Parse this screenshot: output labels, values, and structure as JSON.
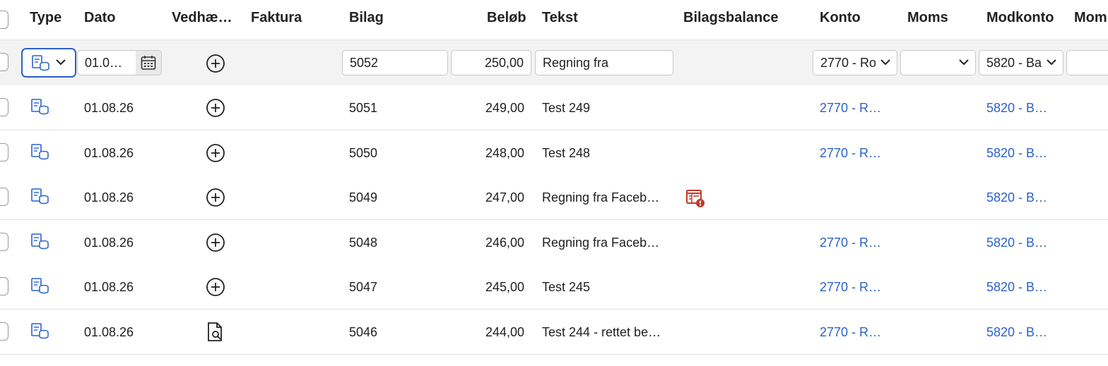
{
  "header": {
    "type": "Type",
    "dato": "Dato",
    "vedhaeftning": "Vedhæ…",
    "faktura": "Faktura",
    "bilag": "Bilag",
    "beloeb": "Beløb",
    "tekst": "Tekst",
    "bilagsbalance": "Bilagsbalance",
    "konto": "Konto",
    "moms": "Moms",
    "modkonto": "Modkonto",
    "mom2": "Mom"
  },
  "edit_row": {
    "date": "01.0…",
    "bilag": "5052",
    "beloeb": "250,00",
    "tekst": "Regning fra",
    "konto": "2770 - Ro",
    "moms": "",
    "modkonto": "5820 - Ba",
    "mom2": ""
  },
  "rows": [
    {
      "date": "01.08.26",
      "attach": "add-circle-icon",
      "bilag": "5051",
      "beloeb": "249,00",
      "tekst": "Test 249",
      "konto": "2770 - R…",
      "modkonto": "5820 - B…"
    },
    {
      "date": "01.08.26",
      "attach": "add-circle-icon",
      "bilag": "5050",
      "beloeb": "248,00",
      "tekst": "Test 248",
      "konto": "2770 - R…",
      "modkonto": "5820 - B…"
    },
    {
      "date": "01.08.26",
      "attach": "add-circle-icon",
      "bilag": "5049",
      "beloeb": "247,00",
      "tekst": "Regning fra Faceb…",
      "konto": "",
      "modkonto": "5820 - B…",
      "balance_icon": "balance-warning-icon"
    },
    {
      "date": "01.08.26",
      "attach": "add-circle-icon",
      "bilag": "5048",
      "beloeb": "246,00",
      "tekst": "Regning fra Faceb…",
      "konto": "2770 - R…",
      "modkonto": "5820 - B…"
    },
    {
      "date": "01.08.26",
      "attach": "add-circle-icon",
      "bilag": "5047",
      "beloeb": "245,00",
      "tekst": "Test 245",
      "konto": "2770 - R…",
      "modkonto": "5820 - B…"
    },
    {
      "date": "01.08.26",
      "attach": "document-search-icon",
      "bilag": "5046",
      "beloeb": "244,00",
      "tekst": "Test 244 - rettet be…",
      "konto": "2770 - R…",
      "modkonto": "5820 - B…"
    }
  ],
  "colors": {
    "link": "#2a62c9",
    "focus": "#2a62c9",
    "warning": "#c0392b"
  }
}
